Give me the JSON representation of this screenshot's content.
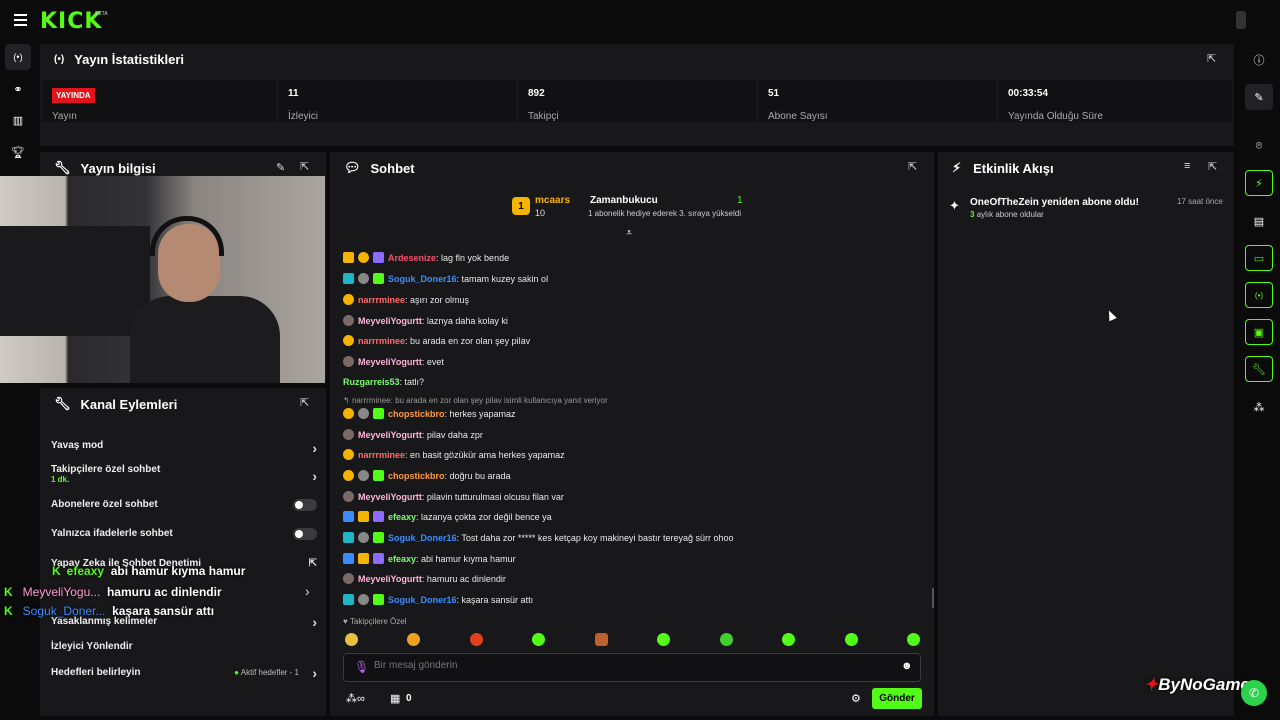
{
  "brand": {
    "name": "KICK",
    "beta": "BETA"
  },
  "stats": {
    "title": "Yayın İstatistikleri",
    "items": [
      {
        "value": "YAYINDA",
        "label": "Yayın"
      },
      {
        "value": "11",
        "label": "İzleyici"
      },
      {
        "value": "892",
        "label": "Takipçi"
      },
      {
        "value": "51",
        "label": "Abone Sayısı"
      },
      {
        "value": "00:33:54",
        "label": "Yayında Olduğu Süre"
      }
    ]
  },
  "info": {
    "title": "Yayın bilgisi"
  },
  "actions": {
    "title": "Kanal Eylemleri",
    "slow": "Yavaş mod",
    "followers": "Takipçilere özel sohbet",
    "followers_time": "1 dk.",
    "subs": "Abonelere özel sohbet",
    "emotes": "Yalnızca ifadelerle sohbet",
    "ai": "Yapay Zeka ile Sohbet Denetimi",
    "banned": "Yasaklanmış kelimeler",
    "redirect": "İzleyici Yönlendir",
    "goals": "Hedefleri belirleyin",
    "goals_status": "Aktif hedefler - 1"
  },
  "overlay": [
    {
      "name": "efeaxy",
      "text": "abi hamur kıyma hamur",
      "color": "#53fc18"
    },
    {
      "name": "MeyveliYogu...",
      "text": "hamuru ac dinlendir",
      "color": "#ff9bd0"
    },
    {
      "name": "Soguk_Doner...",
      "text": "kaşara sansür attı",
      "color": "#3a8cff"
    }
  ],
  "chat": {
    "title": "Sohbet",
    "pinned": {
      "name": "mcaars",
      "count": "10",
      "gifter": "Zamanbukucu",
      "gift_count": "1",
      "note": "1 abonelik hediye ederek 3. sıraya yükseldi"
    },
    "messages": [
      {
        "name": "Ardesenize",
        "text": ": lag fln yok bende",
        "color": "#ff4d6d"
      },
      {
        "name": "Soguk_Doner16",
        "text": ": tamam kuzey sakin ol",
        "color": "#3a8cff"
      },
      {
        "name": "narrrminee",
        "text": ": aşırı zor olmuş",
        "color": "#ff6b6b"
      },
      {
        "name": "MeyveliYogurtt",
        "text": ": laznya daha kolay ki",
        "color": "#ffb3d9"
      },
      {
        "name": "narrrminee",
        "text": ": bu arada en zor olan şey pilav",
        "color": "#ff6b6b"
      },
      {
        "name": "MeyveliYogurtt",
        "text": ": evet",
        "color": "#ffb3d9"
      },
      {
        "name": "Ruzgarreis53",
        "text": ": tatlı?",
        "color": "#7dfc6f"
      },
      {
        "name": "chopstickbro",
        "text": ": herkes yapamaz",
        "color": "#ff9a3c"
      },
      {
        "name": "MeyveliYogurtt",
        "text": ": pilav daha zpr",
        "color": "#ffb3d9"
      },
      {
        "name": "narrrminee",
        "text": ": en basit gözükür ama herkes yapamaz",
        "color": "#ff6b6b"
      },
      {
        "name": "chopstickbro",
        "text": ": doğru bu arada",
        "color": "#ff9a3c"
      },
      {
        "name": "MeyveliYogurtt",
        "text": ": pilavin tutturulmasi olcusu filan var",
        "color": "#ffb3d9"
      },
      {
        "name": "efeaxy",
        "text": ": lazanya çokta zor değil bence ya",
        "color": "#7dfc6f"
      },
      {
        "name": "Soguk_Doner16",
        "text": ": Tost daha zor ***** kes ketçap koy makineyi bastır tereyağ sürr ohoo",
        "color": "#3a8cff"
      },
      {
        "name": "efeaxy",
        "text": ": abi hamur kıyma hamur",
        "color": "#7dfc6f"
      },
      {
        "name": "MeyveliYogurtt",
        "text": ": hamuru ac dinlendir",
        "color": "#ffb3d9"
      },
      {
        "name": "Soguk_Doner16",
        "text": ": kaşara sansür attı",
        "color": "#3a8cff"
      }
    ],
    "reply_note": "narrrminee: bu arada en zor olan şey pilav isimli kullanıcıya yanıt veriyor",
    "followers_only": "Takipçilere Özel",
    "placeholder": "Bir mesaj gönderin",
    "send": "Gönder",
    "count": "0"
  },
  "events": {
    "title": "Etkinlik Akışı",
    "item": "OneOfTheZein yeniden abone oldu!",
    "months": "3",
    "sub": "aylık abone oldular",
    "time": "17 saat önce"
  },
  "watermark": "ByNoGame"
}
